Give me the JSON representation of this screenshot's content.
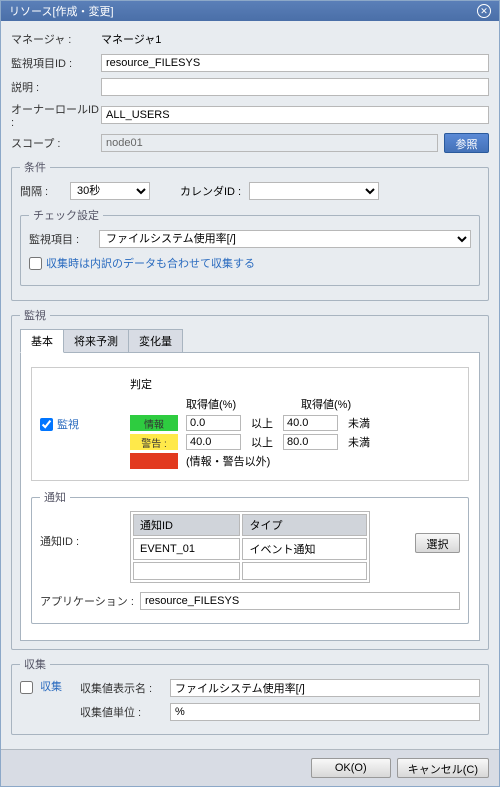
{
  "title": "リソース[作成・変更]",
  "fields": {
    "manager_lbl": "マネージャ :",
    "manager_val": "マネージャ1",
    "monid_lbl": "監視項目ID :",
    "monid_val": "resource_FILESYS",
    "desc_lbl": "説明 :",
    "desc_val": "",
    "owner_lbl": "オーナーロールID :",
    "owner_val": "ALL_USERS",
    "scope_lbl": "スコープ :",
    "scope_val": "node01",
    "scope_btn": "参照"
  },
  "cond": {
    "legend": "条件",
    "interval_lbl": "間隔 :",
    "interval_val": "30秒",
    "cal_lbl": "カレンダID :",
    "check_legend": "チェック設定",
    "monitem_lbl": "監視項目 :",
    "monitem_val": "ファイルシステム使用率[/]",
    "collect_note": "収集時は内訳のデータも合わせて収集する"
  },
  "monitor": {
    "legend": "監視",
    "tabs": {
      "basic": "基本",
      "forecast": "将来予測",
      "change": "変化量"
    },
    "chk_lbl": "監視",
    "judge_lbl": "判定",
    "col1": "取得値(%)",
    "col2": "取得値(%)",
    "info_lbl": "情報",
    "warn_lbl": "警告 :",
    "other_lbl": "(情報・警告以外)",
    "ijou": "以上",
    "miman": "未満",
    "v_info_lo": "0.0",
    "v_info_hi": "40.0",
    "v_warn_lo": "40.0",
    "v_warn_hi": "80.0",
    "notify_legend": "通知",
    "notifyid_lbl": "通知ID :",
    "tbl_h1": "通知ID",
    "tbl_h2": "タイプ",
    "tbl_r1c1": "EVENT_01",
    "tbl_r1c2": "イベント通知",
    "select_btn": "選択",
    "app_lbl": "アプリケーション :",
    "app_val": "resource_FILESYS"
  },
  "collect": {
    "legend": "収集",
    "chk_lbl": "収集",
    "dispname_lbl": "収集値表示名 :",
    "dispname_val": "ファイルシステム使用率[/]",
    "unit_lbl": "収集値単位 :",
    "unit_val": "%"
  },
  "footer": {
    "ok": "OK(O)",
    "cancel": "キャンセル(C)"
  }
}
